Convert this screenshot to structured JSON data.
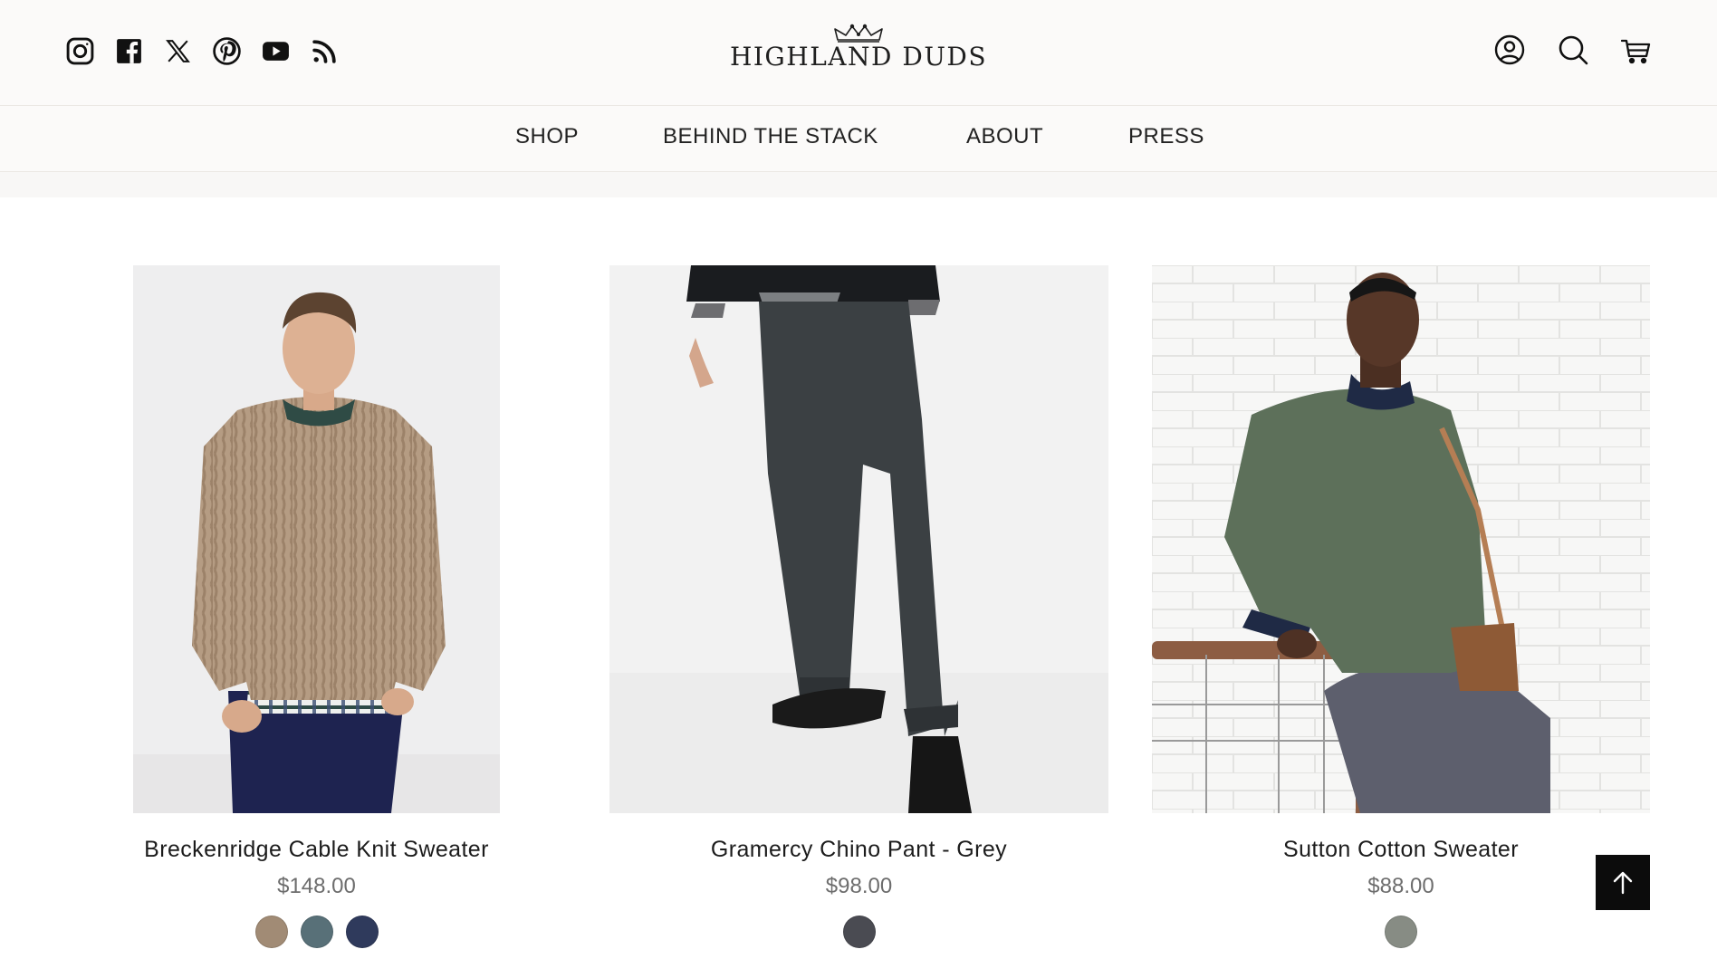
{
  "brand": {
    "name": "HIGHLAND DUDS"
  },
  "social_icons": [
    "instagram-icon",
    "facebook-icon",
    "x-icon",
    "pinterest-icon",
    "youtube-icon",
    "rss-icon"
  ],
  "utility_icons": [
    "account-icon",
    "search-icon",
    "cart-icon"
  ],
  "nav": {
    "items": [
      "SHOP",
      "BEHIND THE STACK",
      "ABOUT",
      "PRESS"
    ]
  },
  "products": [
    {
      "title": "Breckenridge Cable Knit Sweater",
      "price": "$148.00",
      "swatches": [
        "#a18b75",
        "#587078",
        "#2f3a5c"
      ]
    },
    {
      "title": "Gramercy Chino Pant - Grey",
      "price": "$98.00",
      "swatches": [
        "#4a4b52"
      ]
    },
    {
      "title": "Sutton Cotton Sweater",
      "price": "$88.00",
      "swatches": [
        "#878c84"
      ]
    }
  ],
  "colors": {
    "header_bg": "#fbfaf9",
    "text": "#1a1a1a",
    "price": "#6d6d6d",
    "back_to_top": "#0c0c0c"
  },
  "back_to_top_icon": "arrow-up-icon"
}
